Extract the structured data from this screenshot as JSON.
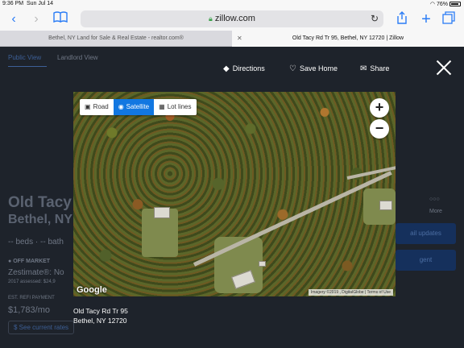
{
  "status_bar": {
    "time": "9:36 PM",
    "date": "Sun Jul 14",
    "battery": "76%"
  },
  "toolbar": {
    "url": "zillow.com"
  },
  "tabs": [
    {
      "label": "Bethel, NY Land for Sale & Real Estate - realtor.com®"
    },
    {
      "label": "Old Tacy Rd Tr 95, Bethel, NY 12720 | Zillow"
    }
  ],
  "background_page": {
    "tab_public": "Public View",
    "tab_landlord": "Landlord View",
    "title_line1": "Old Tacy",
    "title_line2": "Bethel, NY",
    "beds_baths": "-- beds · -- bath",
    "status": "OFF MARKET",
    "zestimate": "Zestimate®: No",
    "assessed": "2017 assessed: $24,9",
    "refi_label": "EST. REFI PAYMENT",
    "refi_value": "$1,783/mo",
    "see_rates": "See current rates",
    "more": "More",
    "btn1": "ail updates",
    "btn2": "gent"
  },
  "overlay": {
    "directions": "Directions",
    "save_home": "Save Home",
    "share": "Share"
  },
  "map": {
    "type_road": "Road",
    "type_satellite": "Satellite",
    "type_lot_lines": "Lot lines",
    "selected_type": "Satellite",
    "zoom_in": "+",
    "zoom_out": "−",
    "logo": "Google",
    "attribution": "Imagery ©2019 , DigitalGlobe",
    "terms": "Terms of Use"
  },
  "caption": {
    "line1": "Old Tacy Rd Tr 95",
    "line2": "Bethel, NY 12720"
  },
  "colors": {
    "accent": "#2a7cf6",
    "selected": "#1277e1"
  }
}
